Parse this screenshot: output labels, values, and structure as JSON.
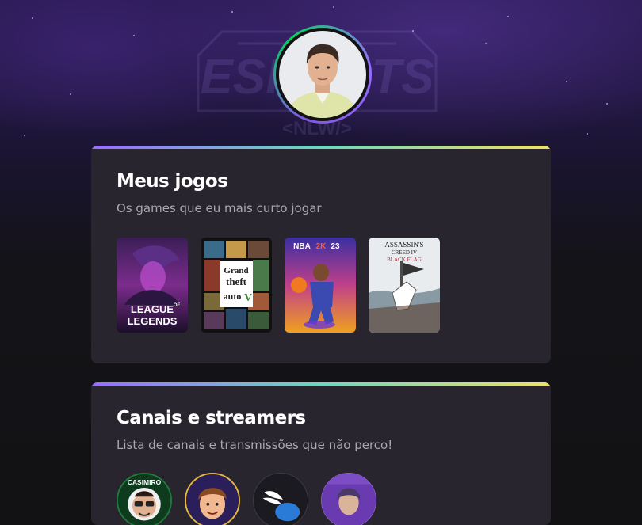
{
  "profile": {
    "avatar_icon": "profile-avatar",
    "ring_colors": [
      "#8257e5",
      "#04d361",
      "#996dff"
    ]
  },
  "background": {
    "logo_text": "ESPORTS",
    "logo_subtext": "<NLW/>"
  },
  "games_section": {
    "title": "Meus jogos",
    "subtitle": "Os games que eu mais curto jogar",
    "games": [
      {
        "cover_lines": [
          "LEAGUE",
          "OF",
          "LEGENDS"
        ],
        "accent": "#c23bd8"
      },
      {
        "cover_lines": [
          "Grand",
          "theft",
          "auto",
          "V"
        ],
        "accent": "#e0a020"
      },
      {
        "cover_lines": [
          "NBA",
          "2K",
          "23"
        ],
        "accent": "#e65a1c"
      },
      {
        "cover_lines": [
          "ASSASSIN'S",
          "CREED IV",
          "BLACK FLAG"
        ],
        "accent": "#b3202a"
      }
    ]
  },
  "streamers_section": {
    "title": "Canais e streamers",
    "subtitle": "Lista de canais e transmissões que não perco!",
    "streamers": [
      {
        "avatar_icon": "casimiro-avatar",
        "badge_text": "CASIMIRO",
        "ring": "#1f7a3a"
      },
      {
        "avatar_icon": "cartoon-streamer-avatar",
        "ring": "#e2b640"
      },
      {
        "avatar_icon": "winged-logo-avatar",
        "ring": "#3a3a44"
      },
      {
        "avatar_icon": "streamer-photo-avatar",
        "ring": "#8a5ad6"
      }
    ]
  },
  "gradient_colors": [
    "#996dff",
    "#6fd6c0",
    "#f0e06a"
  ]
}
